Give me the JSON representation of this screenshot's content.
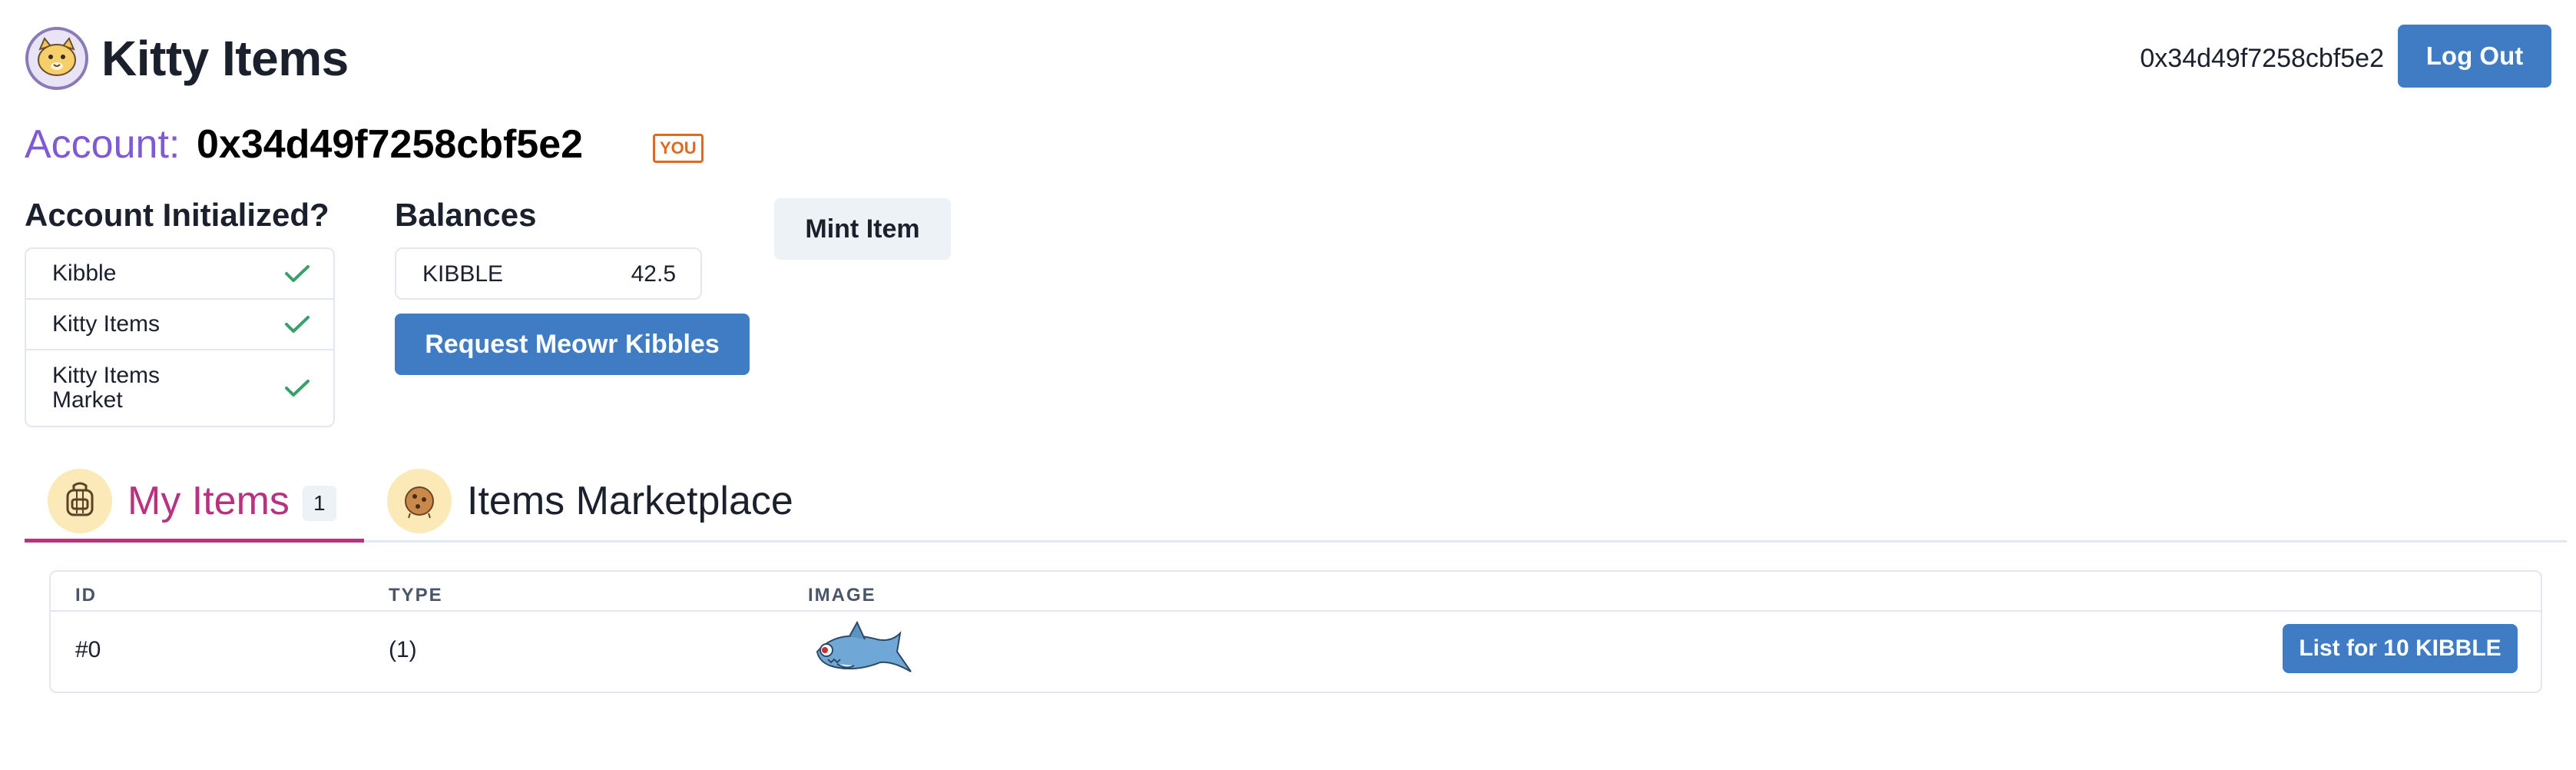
{
  "header": {
    "title": "Kitty Items",
    "address": "0x34d49f7258cbf5e2",
    "logout_label": "Log Out"
  },
  "account": {
    "label": "Account:",
    "address": "0x34d49f7258cbf5e2",
    "badge": "YOU"
  },
  "initialized": {
    "heading": "Account Initialized?",
    "items": [
      {
        "label": "Kibble",
        "status": "check"
      },
      {
        "label": "Kitty Items",
        "status": "check"
      },
      {
        "label": "Kitty Items Market",
        "status": "check"
      }
    ]
  },
  "balances": {
    "heading": "Balances",
    "token": "KIBBLE",
    "amount": "42.5",
    "request_label": "Request Meowr Kibbles"
  },
  "mint_label": "Mint Item",
  "tabs": [
    {
      "label": "My Items",
      "count": "1",
      "icon": "backpack-icon",
      "active": true
    },
    {
      "label": "Items Marketplace",
      "icon": "cookie-icon",
      "active": false
    }
  ],
  "table": {
    "columns": [
      "ID",
      "TYPE",
      "IMAGE"
    ],
    "rows": [
      {
        "id": "#0",
        "type": "(1)",
        "image": "fish-icon",
        "action_label": "List for 10 KIBBLE"
      }
    ]
  },
  "colors": {
    "primary": "#3f7cc4",
    "account_label": "#805ad5",
    "active_tab": "#b83280",
    "badge": "#dd6b20",
    "check": "#38a169"
  }
}
